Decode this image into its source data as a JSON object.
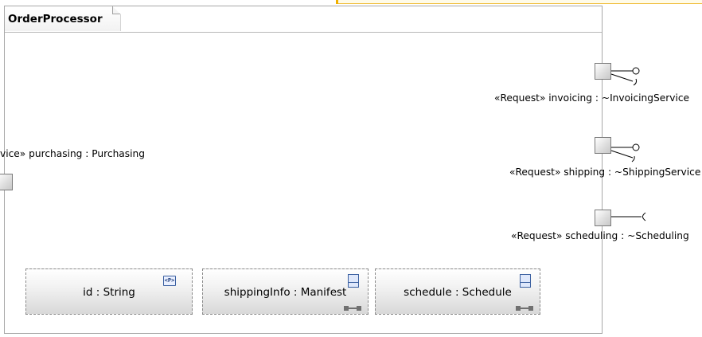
{
  "diagram": {
    "title": "OrderProcessor",
    "ports": [
      {
        "id": "invoicing",
        "label": "«Request» invoicing : ~InvoicingService",
        "interface": "provided-and-required"
      },
      {
        "id": "shipping",
        "label": "«Request» shipping : ~ShippingService",
        "interface": "provided-and-required"
      },
      {
        "id": "scheduling",
        "label": "«Request» scheduling : ~Scheduling",
        "interface": "required"
      },
      {
        "id": "purchasing",
        "label": "vice» purchasing : Purchasing",
        "interface": "none"
      }
    ],
    "parts": [
      {
        "id": "id",
        "label": "id : String",
        "icon": "property-icon",
        "icon_text": "<P>"
      },
      {
        "id": "shippingInfo",
        "label": "shippingInfo : Manifest",
        "icon": "class-icon"
      },
      {
        "id": "schedule",
        "label": "schedule : Schedule",
        "icon": "class-icon"
      }
    ]
  },
  "colors": {
    "frame_border": "#a8a8a8",
    "icon_blue": "#3a5fa0",
    "highlight": "#f0b000"
  }
}
